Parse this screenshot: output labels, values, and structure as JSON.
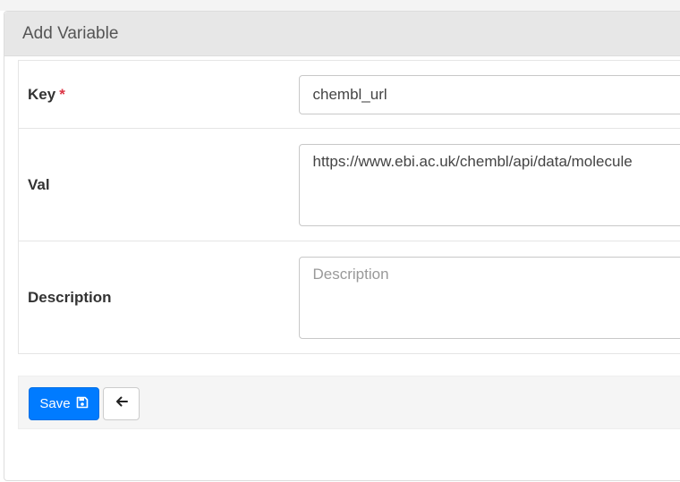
{
  "panel": {
    "title": "Add Variable"
  },
  "fields": {
    "key": {
      "label": "Key",
      "required_mark": "*",
      "value": "chembl_url"
    },
    "val": {
      "label": "Val",
      "value": "https://www.ebi.ac.uk/chembl/api/data/molecule"
    },
    "description": {
      "label": "Description",
      "value": "",
      "placeholder": "Description"
    }
  },
  "actions": {
    "save_label": "Save",
    "save_icon": "floppy-disk-icon",
    "back_icon": "arrow-left-icon",
    "primary_color": "#007bff"
  }
}
